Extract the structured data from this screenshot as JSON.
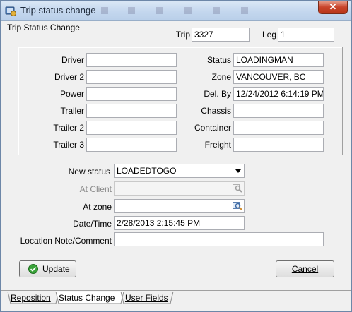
{
  "window": {
    "title": "Trip status change",
    "close_glyph": "✕"
  },
  "form": {
    "section_title": "Trip Status Change",
    "trip_label": "Trip",
    "trip_value": "3327",
    "leg_label": "Leg",
    "leg_value": "1"
  },
  "left_fields": [
    {
      "label": "Driver",
      "value": ""
    },
    {
      "label": "Driver 2",
      "value": ""
    },
    {
      "label": "Power",
      "value": ""
    },
    {
      "label": "Trailer",
      "value": ""
    },
    {
      "label": "Trailer 2",
      "value": ""
    },
    {
      "label": "Trailer 3",
      "value": ""
    }
  ],
  "right_fields": [
    {
      "label": "Status",
      "value": "LOADINGMAN"
    },
    {
      "label": "Zone",
      "value": "VANCOUVER, BC"
    },
    {
      "label": "Del. By",
      "value": "12/24/2012 6:14:19 PM"
    },
    {
      "label": "Chassis",
      "value": ""
    },
    {
      "label": "Container",
      "value": ""
    },
    {
      "label": "Freight",
      "value": ""
    }
  ],
  "new_status": {
    "label": "New status",
    "selected": "LOADEDTOGO"
  },
  "at_client": {
    "label": "At Client",
    "value": ""
  },
  "at_zone": {
    "label": "At zone",
    "value": ""
  },
  "date_time": {
    "label": "Date/Time",
    "value": "2/28/2013 2:15:45 PM"
  },
  "location_note": {
    "label": "Location Note/Comment",
    "value": ""
  },
  "buttons": {
    "update": "Update",
    "cancel": "Cancel"
  },
  "tabs": [
    {
      "label": "Reposition"
    },
    {
      "label": "Status Change"
    },
    {
      "label": "User Fields"
    }
  ],
  "colors": {
    "title_text": "#1e2a3a",
    "update_icon": "#3aa33a",
    "lookup_icon": "#5a7fb0"
  }
}
